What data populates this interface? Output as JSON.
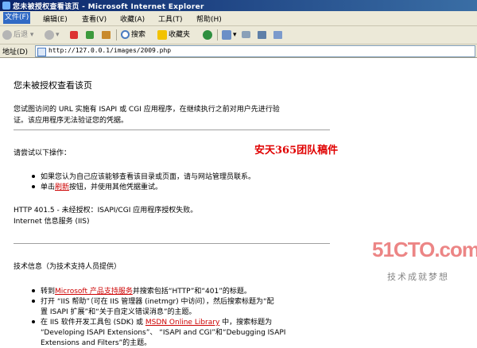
{
  "window": {
    "title": "您未被授权查看该页 - Microsoft Internet Explorer"
  },
  "menu": [
    "文件(F)",
    "编辑(E)",
    "查看(V)",
    "收藏(A)",
    "工具(T)",
    "帮助(H)"
  ],
  "toolbar": {
    "back": "后退",
    "search": "搜索",
    "favorites": "收藏夹"
  },
  "address": {
    "label": "地址(D)",
    "url": "http://127.0.0.1/images/2009.php"
  },
  "page": {
    "title": "您未被授权查看该页",
    "intro_line1": "您试图访问的 URL 实施有 ISAPI 或 CGI 应用程序，在继续执行之前对用户先进行验",
    "intro_line2": "证。该应用程序无法验证您的凭据。",
    "try_heading": "请尝试以下操作：",
    "try_item1": "如果您认为自己应该能够查看该目录或页面，请与网站管理员联系。",
    "try_item2_pre": "单击",
    "try_item2_link": "刷新",
    "try_item2_post": "按钮，并使用其他凭据重试。",
    "error_line1": "HTTP 401.5 - 未经授权：ISAPI/CGI 应用程序授权失败。",
    "error_line2": "Internet 信息服务 (IIS)",
    "tech_heading": "技术信息（为技术支持人员提供）",
    "tech_item1_pre": "转到",
    "tech_item1_link": "Microsoft 产品支持服务",
    "tech_item1_post": "并搜索包括“HTTP”和“401”的标题。",
    "tech_item2_line1": "打开 “IIS 帮助”（可在 IIS 管理器 (inetmgr) 中访问），然后搜索标题为“配",
    "tech_item2_line2": "置 ISAPI 扩展”和“关于自定义错误消息”的主题。",
    "tech_item3_pre": "在 IIS 软件开发工具包 (SDK) 或",
    "tech_item3_link": "MSDN Online Library",
    "tech_item3_post": "中，搜索标题为",
    "tech_item3_line2": "“Developing ISAPI Extensions”、 “ISAPI and CGI”和“Debugging ISAPI",
    "tech_item3_line3": "Extensions and Filters”的主题。"
  },
  "overlay": {
    "watermark": "安天365团队稿件",
    "logo": "51CTO.com",
    "slogan": "技术成就梦想"
  }
}
